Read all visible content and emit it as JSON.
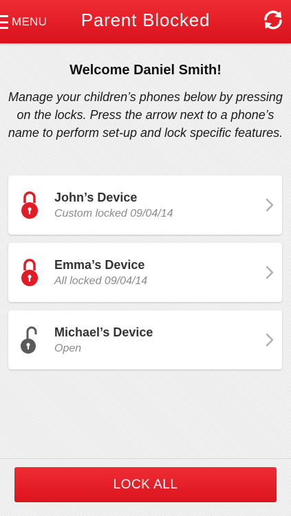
{
  "header": {
    "menu_label": "MENU",
    "title": "Parent Blocked",
    "menu_icon": "hamburger-icon",
    "refresh_icon": "refresh-icon",
    "bar_color": "#e31b24"
  },
  "intro": {
    "welcome": "Welcome Daniel Smith!",
    "instructions": "Manage your children’s phones below by pressing on the locks. Press the arrow next to a phone’s name to perform set-up and lock specific features."
  },
  "devices": [
    {
      "name": "John’s Device",
      "status": "Custom locked 09/04/14",
      "locked": true,
      "icon": "padlock-locked-icon",
      "lock_color": "#e31b24"
    },
    {
      "name": "Emma’s Device",
      "status": "All locked 09/04/14",
      "locked": true,
      "icon": "padlock-locked-icon",
      "lock_color": "#e31b24"
    },
    {
      "name": "Michael’s Device",
      "status": "Open",
      "locked": false,
      "icon": "padlock-open-icon",
      "lock_color": "#5a5a5a"
    }
  ],
  "footer": {
    "lock_all_label": "LOCK ALL",
    "button_color": "#e31b24"
  }
}
